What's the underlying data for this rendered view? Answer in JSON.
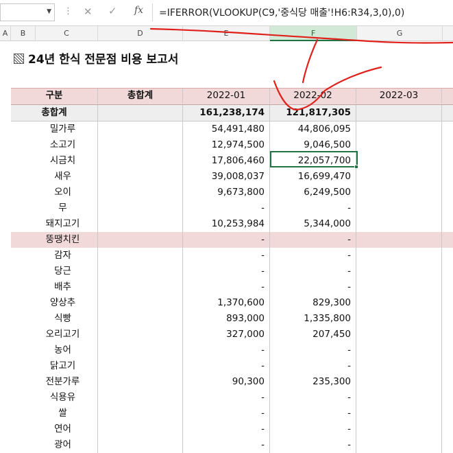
{
  "formula_bar": {
    "cell_ref": "",
    "cancel_icon": "close-icon",
    "enter_icon": "check-icon",
    "fx_label": "fx",
    "formula": "=IFERROR(VLOOKUP(C9,'중식당 매출'!H6:R34,3,0),0)"
  },
  "columns": [
    "A",
    "B",
    "C",
    "D",
    "E",
    "F",
    "G"
  ],
  "selected_column": "F",
  "title": "24년 한식 전문점 비용 보고서",
  "table": {
    "headers": [
      "구분",
      "총합계",
      "2022-01",
      "2022-02",
      "2022-03"
    ],
    "total": {
      "label": "총합계",
      "sum": "",
      "m1": "161,238,174",
      "m2": "121,817,305",
      "m3": ""
    },
    "rows": [
      {
        "label": "밀가루",
        "sum": "",
        "m1": "54,491,480",
        "m2": "44,806,095",
        "m3": ""
      },
      {
        "label": "소고기",
        "sum": "",
        "m1": "12,974,500",
        "m2": "9,046,500",
        "m3": ""
      },
      {
        "label": "시금치",
        "sum": "",
        "m1": "17,806,460",
        "m2": "22,057,700",
        "m3": ""
      },
      {
        "label": "새우",
        "sum": "",
        "m1": "39,008,037",
        "m2": "16,699,470",
        "m3": ""
      },
      {
        "label": "오이",
        "sum": "",
        "m1": "9,673,800",
        "m2": "6,249,500",
        "m3": ""
      },
      {
        "label": "무",
        "sum": "",
        "m1": "-",
        "m2": "-",
        "m3": ""
      },
      {
        "label": "돼지고기",
        "sum": "",
        "m1": "10,253,984",
        "m2": "5,344,000",
        "m3": ""
      },
      {
        "label": "뚱땡치킨",
        "sum": "",
        "m1": "-",
        "m2": "-",
        "m3": "",
        "highlight": true
      },
      {
        "label": "감자",
        "sum": "",
        "m1": "-",
        "m2": "-",
        "m3": ""
      },
      {
        "label": "당근",
        "sum": "",
        "m1": "-",
        "m2": "-",
        "m3": ""
      },
      {
        "label": "배추",
        "sum": "",
        "m1": "-",
        "m2": "-",
        "m3": ""
      },
      {
        "label": "양상추",
        "sum": "",
        "m1": "1,370,600",
        "m2": "829,300",
        "m3": ""
      },
      {
        "label": "식빵",
        "sum": "",
        "m1": "893,000",
        "m2": "1,335,800",
        "m3": ""
      },
      {
        "label": "오리고기",
        "sum": "",
        "m1": "327,000",
        "m2": "207,450",
        "m3": ""
      },
      {
        "label": "농어",
        "sum": "",
        "m1": "-",
        "m2": "-",
        "m3": ""
      },
      {
        "label": "닭고기",
        "sum": "",
        "m1": "-",
        "m2": "-",
        "m3": ""
      },
      {
        "label": "전분가루",
        "sum": "",
        "m1": "90,300",
        "m2": "235,300",
        "m3": ""
      },
      {
        "label": "식용유",
        "sum": "",
        "m1": "-",
        "m2": "-",
        "m3": ""
      },
      {
        "label": "쌀",
        "sum": "",
        "m1": "-",
        "m2": "-",
        "m3": ""
      },
      {
        "label": "연어",
        "sum": "",
        "m1": "-",
        "m2": "-",
        "m3": ""
      },
      {
        "label": "광어",
        "sum": "",
        "m1": "-",
        "m2": "-",
        "m3": ""
      }
    ]
  },
  "colors": {
    "header_fill": "#f1d9d9",
    "total_fill": "#eeeeee",
    "selection": "#217346",
    "annotation": "#e0201a"
  }
}
